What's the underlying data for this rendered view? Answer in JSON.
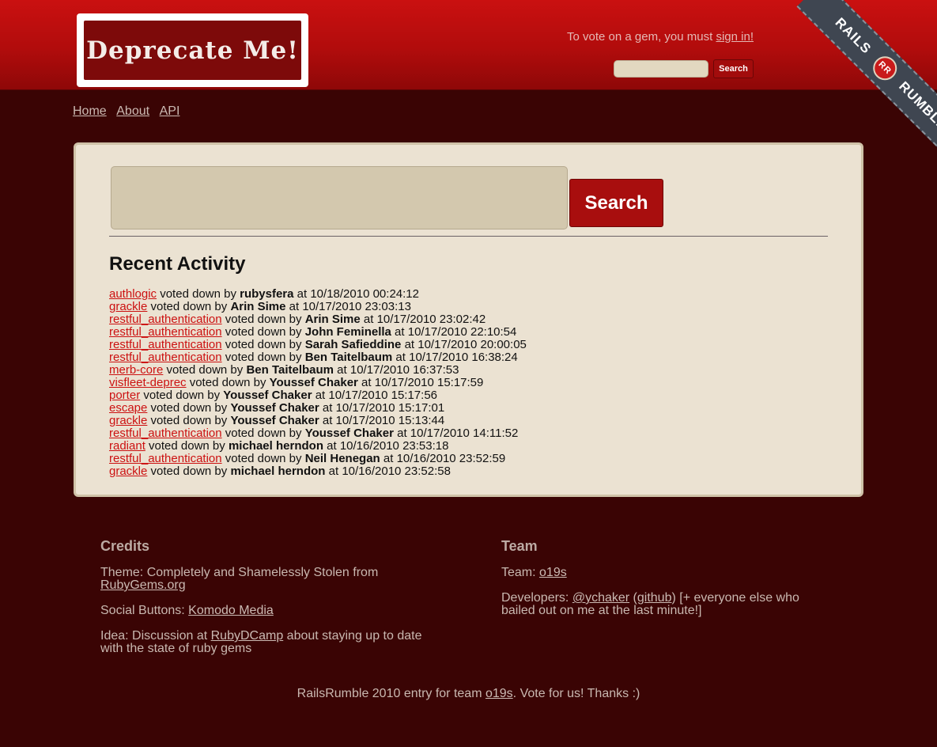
{
  "header": {
    "logo_text": "Deprecate Me!",
    "vote_prefix": "To vote on a gem, you must ",
    "vote_link": "sign in!",
    "search_button": "Search",
    "ribbon_left": "RAILS",
    "ribbon_badge": "RR",
    "ribbon_right": "RUMBLE"
  },
  "nav": {
    "items": [
      {
        "label": "Home"
      },
      {
        "label": "About"
      },
      {
        "label": "API"
      }
    ]
  },
  "main": {
    "search_button": "Search",
    "activity_title": "Recent Activity",
    "activities": [
      {
        "gem": "authlogic",
        "action": " voted down by ",
        "user": "rubysfera",
        "time": " at 10/18/2010 00:24:12"
      },
      {
        "gem": "grackle",
        "action": " voted down by ",
        "user": "Arin Sime",
        "time": " at 10/17/2010 23:03:13"
      },
      {
        "gem": "restful_authentication",
        "action": " voted down by ",
        "user": "Arin Sime",
        "time": " at 10/17/2010 23:02:42"
      },
      {
        "gem": "restful_authentication",
        "action": " voted down by ",
        "user": "John Feminella",
        "time": " at 10/17/2010 22:10:54"
      },
      {
        "gem": "restful_authentication",
        "action": " voted down by ",
        "user": "Sarah Safieddine",
        "time": " at 10/17/2010 20:00:05"
      },
      {
        "gem": "restful_authentication",
        "action": " voted down by ",
        "user": "Ben Taitelbaum",
        "time": " at 10/17/2010 16:38:24"
      },
      {
        "gem": "merb-core",
        "action": " voted down by ",
        "user": "Ben Taitelbaum",
        "time": " at 10/17/2010 16:37:53"
      },
      {
        "gem": "visfleet-deprec",
        "action": " voted down by ",
        "user": "Youssef Chaker",
        "time": " at 10/17/2010 15:17:59"
      },
      {
        "gem": "porter",
        "action": " voted down by ",
        "user": "Youssef Chaker",
        "time": " at 10/17/2010 15:17:56"
      },
      {
        "gem": "escape",
        "action": " voted down by ",
        "user": "Youssef Chaker",
        "time": " at 10/17/2010 15:17:01"
      },
      {
        "gem": "grackle",
        "action": " voted down by ",
        "user": "Youssef Chaker",
        "time": " at 10/17/2010 15:13:44"
      },
      {
        "gem": "restful_authentication",
        "action": " voted down by ",
        "user": "Youssef Chaker",
        "time": " at 10/17/2010 14:11:52"
      },
      {
        "gem": "radiant",
        "action": " voted down by ",
        "user": "michael herndon",
        "time": " at 10/16/2010 23:53:18"
      },
      {
        "gem": "restful_authentication",
        "action": " voted down by ",
        "user": "Neil Henegan",
        "time": " at 10/16/2010 23:52:59"
      },
      {
        "gem": "grackle",
        "action": " voted down by ",
        "user": "michael herndon",
        "time": " at 10/16/2010 23:52:58"
      }
    ]
  },
  "footer": {
    "credits_title": "Credits",
    "theme_text": "Theme: Completely and Shamelessly Stolen from ",
    "theme_link": "RubyGems.org",
    "social_text": "Social Buttons: ",
    "social_link": "Komodo Media",
    "idea_text": "Idea: Discussion at ",
    "idea_link": "RubyDCamp",
    "idea_suffix": " about staying up to date with the state of ruby gems",
    "team_title": "Team",
    "team_text": "Team: ",
    "team_link": "o19s",
    "dev_text": "Developers: ",
    "dev_link1": "@ychaker",
    "dev_link2": "github",
    "dev_suffix": " [+ everyone else who bailed out on me at the last minute!]",
    "bottom_text": "RailsRumble 2010 entry for team ",
    "bottom_link": "o19s",
    "bottom_suffix": ". Vote for us! Thanks :)"
  }
}
